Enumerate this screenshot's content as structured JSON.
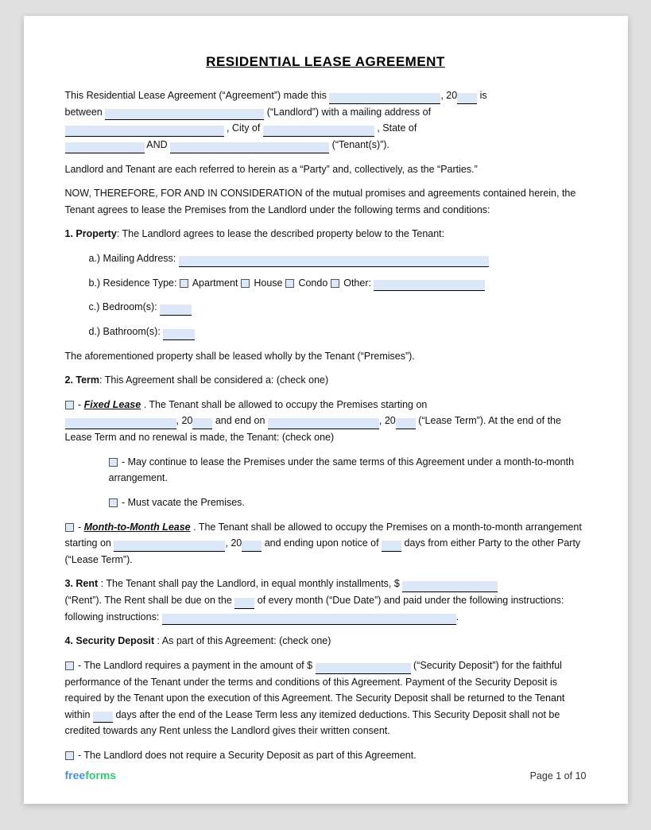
{
  "document": {
    "title": "RESIDENTIAL LEASE AGREEMENT",
    "intro": {
      "line1_pre": "This Residential Lease Agreement (“Agreement”) made this",
      "line1_year": "20",
      "line1_post": "is",
      "line2_pre": "between",
      "line2_landlord_label": "(“Landlord”) with a mailing address of",
      "line3_city_label": ", City of",
      "line3_state_label": ", State of",
      "line4_and": "AND",
      "line4_tenant_label": "(“Tenant(s)”)."
    },
    "parties_note": "Landlord and Tenant are each referred to herein as a “Party” and, collectively, as the “Parties.”",
    "consideration": "NOW, THEREFORE, FOR AND IN CONSIDERATION of the mutual promises and agreements contained herein, the Tenant agrees to lease the Premises from the Landlord under the following terms and conditions:",
    "section1": {
      "heading": "1. Property",
      "intro": ": The Landlord agrees to lease the described property below to the Tenant:",
      "items": [
        {
          "label": "a.)  Mailing Address:",
          "id": "mailing-address"
        },
        {
          "label": "b.)  Residence Type:",
          "id": "residence-type"
        },
        {
          "label": "c.)  Bedroom(s):",
          "id": "bedrooms"
        },
        {
          "label": "d.)  Bathroom(s):",
          "id": "bathrooms"
        }
      ],
      "residence_options": [
        {
          "label": "Apartment"
        },
        {
          "label": "House"
        },
        {
          "label": "Condo"
        },
        {
          "label": "Other:"
        }
      ],
      "premises_note": "The aforementioned property shall be leased wholly by the Tenant (“Premises”)."
    },
    "section2": {
      "heading": "2. Term",
      "intro": ": This Agreement shall be considered a: (check one)",
      "fixed_lease": {
        "label": "Fixed Lease",
        "text1": ". The Tenant shall be allowed to occupy the Premises starting on",
        "year1": "20",
        "text2": "and end on",
        "year2": "20",
        "text3": "(“Lease Term”). At the end of the Lease Term and no renewal is made, the Tenant: (check one)",
        "options": [
          "- May continue to lease the Premises under the same terms of this Agreement under a month-to-month arrangement.",
          "- Must vacate the Premises."
        ]
      },
      "month_lease": {
        "label": "Month-to-Month Lease",
        "text1": ". The Tenant shall be allowed to occupy the Premises on a month-to-month arrangement starting on",
        "year1": "20",
        "text2": "and ending upon notice of",
        "text3": "days from either Party to the other Party (“Lease Term”)."
      }
    },
    "section3": {
      "heading": "3. Rent",
      "text1": ": The Tenant shall pay the Landlord, in equal monthly installments, $",
      "text2": "(“Rent”). The Rent shall be due on the",
      "text3": "of every month (“Due Date”) and paid under the following instructions:"
    },
    "section4": {
      "heading": "4. Security Deposit",
      "intro": ": As part of this Agreement: (check one)",
      "option1_text": "- The Landlord requires a payment in the amount of $",
      "option1_text2": "(“Security Deposit”) for the faithful performance of the Tenant under the terms and conditions of this Agreement. Payment of the Security Deposit is required by the Tenant upon the execution of this Agreement. The Security Deposit shall be returned to the Tenant within",
      "option1_text3": "days after the end of the Lease Term less any itemized deductions. This Security Deposit shall not be credited towards any Rent unless the Landlord gives their written consent.",
      "option2_text": "- The Landlord does not require a Security Deposit as part of this Agreement."
    },
    "footer": {
      "brand_free": "free",
      "brand_forms": "forms",
      "page_info": "Page 1 of 10"
    }
  }
}
